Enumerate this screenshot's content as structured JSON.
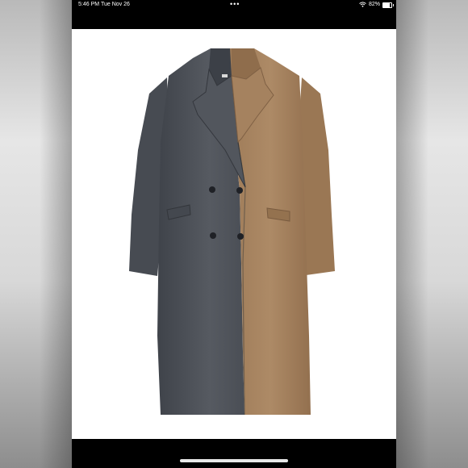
{
  "status_bar": {
    "time": "5:46 PM",
    "date": "Tue Nov 26",
    "dots": "•••",
    "wifi_icon": "wifi-icon",
    "battery_percent": "82%",
    "battery_level": 0.82
  },
  "photo": {
    "subject_icon": "two-tone-coat",
    "colors": {
      "left_panel": "#4f535a",
      "right_panel": "#a98663",
      "background": "#ffffff"
    }
  }
}
